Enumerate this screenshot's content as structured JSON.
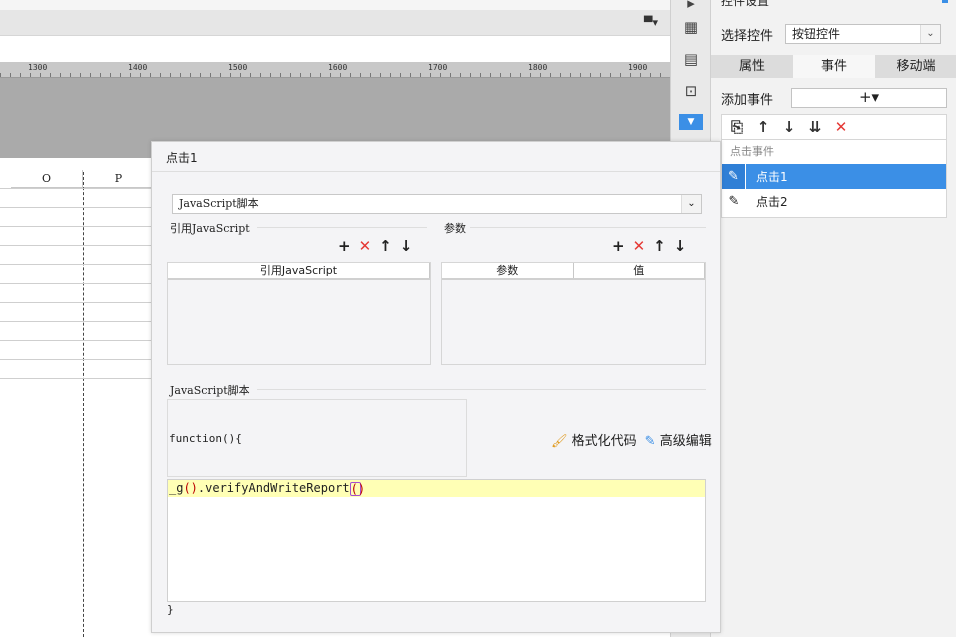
{
  "ruler": {
    "labels": [
      "1300",
      "1400",
      "1500",
      "1600",
      "1700",
      "1800",
      "1900"
    ]
  },
  "sheet": {
    "columns": [
      "O",
      "P"
    ]
  },
  "side_strip": {
    "icons": [
      "chevron-right-icon",
      "layout-icon",
      "info-card-icon",
      "crop-icon",
      "dropdown-active-icon"
    ]
  },
  "right_panel": {
    "title": "控件设置",
    "select_label": "选择控件",
    "select_value": "按钮控件",
    "tabs": [
      "属性",
      "事件",
      "移动端"
    ],
    "active_tab": "事件",
    "add_event_label": "添加事件",
    "add_event_symbol": "+▾",
    "event_header": "点击事件",
    "events": [
      {
        "label": "点击1",
        "selected": true
      },
      {
        "label": "点击2",
        "selected": false
      }
    ]
  },
  "dialog": {
    "title": "点击1",
    "type_value": "JavaScript脚本",
    "ref_js_label": "引用JavaScript",
    "params_label": "参数",
    "ref_table_headers": [
      "引用JavaScript"
    ],
    "param_table_headers": [
      "参数",
      "值"
    ],
    "script_label": "JavaScript脚本",
    "code_head": "function(){",
    "code_body_prefix": "_g",
    "code_body_mid": ".verifyAndWriteReport",
    "code_tail": "}",
    "format_code": "格式化代码",
    "advanced_edit": "高级编辑"
  },
  "colors": {
    "accent": "#3b8fe6",
    "delete": "#e53935",
    "highlight_line": "#ffffb5"
  }
}
